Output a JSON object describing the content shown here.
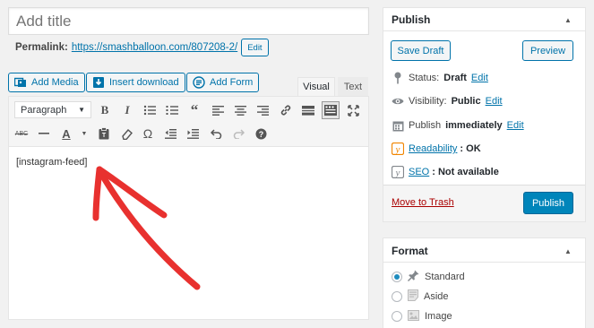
{
  "title_input": {
    "placeholder": "Add title"
  },
  "permalink": {
    "label": "Permalink:",
    "url": "https://smashballoon.com/807208-2/",
    "edit_label": "Edit"
  },
  "media_buttons": [
    {
      "label": "Add Media",
      "icon": "media-icon"
    },
    {
      "label": "Insert download",
      "icon": "download-icon"
    },
    {
      "label": "Add Form",
      "icon": "form-icon"
    }
  ],
  "editor_tabs": {
    "visual": "Visual",
    "text": "Text",
    "active": "visual"
  },
  "toolbar": {
    "format_select": "Paragraph",
    "row1_icons": [
      "bold-icon",
      "italic-icon",
      "bullet-list-icon",
      "numbered-list-icon",
      "blockquote-icon",
      "align-left-icon",
      "align-center-icon",
      "align-right-icon",
      "link-icon",
      "read-more-icon",
      "toolbar-toggle-icon",
      "fullscreen-icon"
    ],
    "row2_icons": [
      "strikethrough-icon",
      "horizontal-line-icon",
      "text-color-icon",
      "paste-text-icon",
      "clear-formatting-icon",
      "special-character-icon",
      "outdent-icon",
      "indent-icon",
      "undo-icon",
      "redo-icon",
      "help-icon"
    ],
    "bold": "B",
    "italic": "I",
    "omega": "Ω",
    "strike": "ABC",
    "text_color": "A"
  },
  "editor_content": "[instagram-feed]",
  "annotation": {
    "type": "red-arrow",
    "color": "#e8312f"
  },
  "publish_box": {
    "title": "Publish",
    "save_draft": "Save Draft",
    "preview": "Preview",
    "status": {
      "label": "Status:",
      "value": "Draft",
      "edit": "Edit"
    },
    "visibility": {
      "label": "Visibility:",
      "value": "Public",
      "edit": "Edit"
    },
    "publish_time": {
      "label": "Publish",
      "value": "immediately",
      "edit": "Edit"
    },
    "readability": {
      "label": "Readability",
      "value": ": OK"
    },
    "seo": {
      "label": "SEO",
      "value": ": Not available"
    },
    "trash": "Move to Trash",
    "publish_btn": "Publish"
  },
  "format_box": {
    "title": "Format",
    "options": [
      {
        "label": "Standard",
        "icon": "pin-icon",
        "selected": true
      },
      {
        "label": "Aside",
        "icon": "aside-icon",
        "selected": false
      },
      {
        "label": "Image",
        "icon": "image-icon",
        "selected": false
      }
    ]
  },
  "colors": {
    "accent": "#0073aa",
    "primary": "#0085ba",
    "trash": "#a00",
    "arrow": "#e8312f",
    "yoast": "#f18500"
  }
}
